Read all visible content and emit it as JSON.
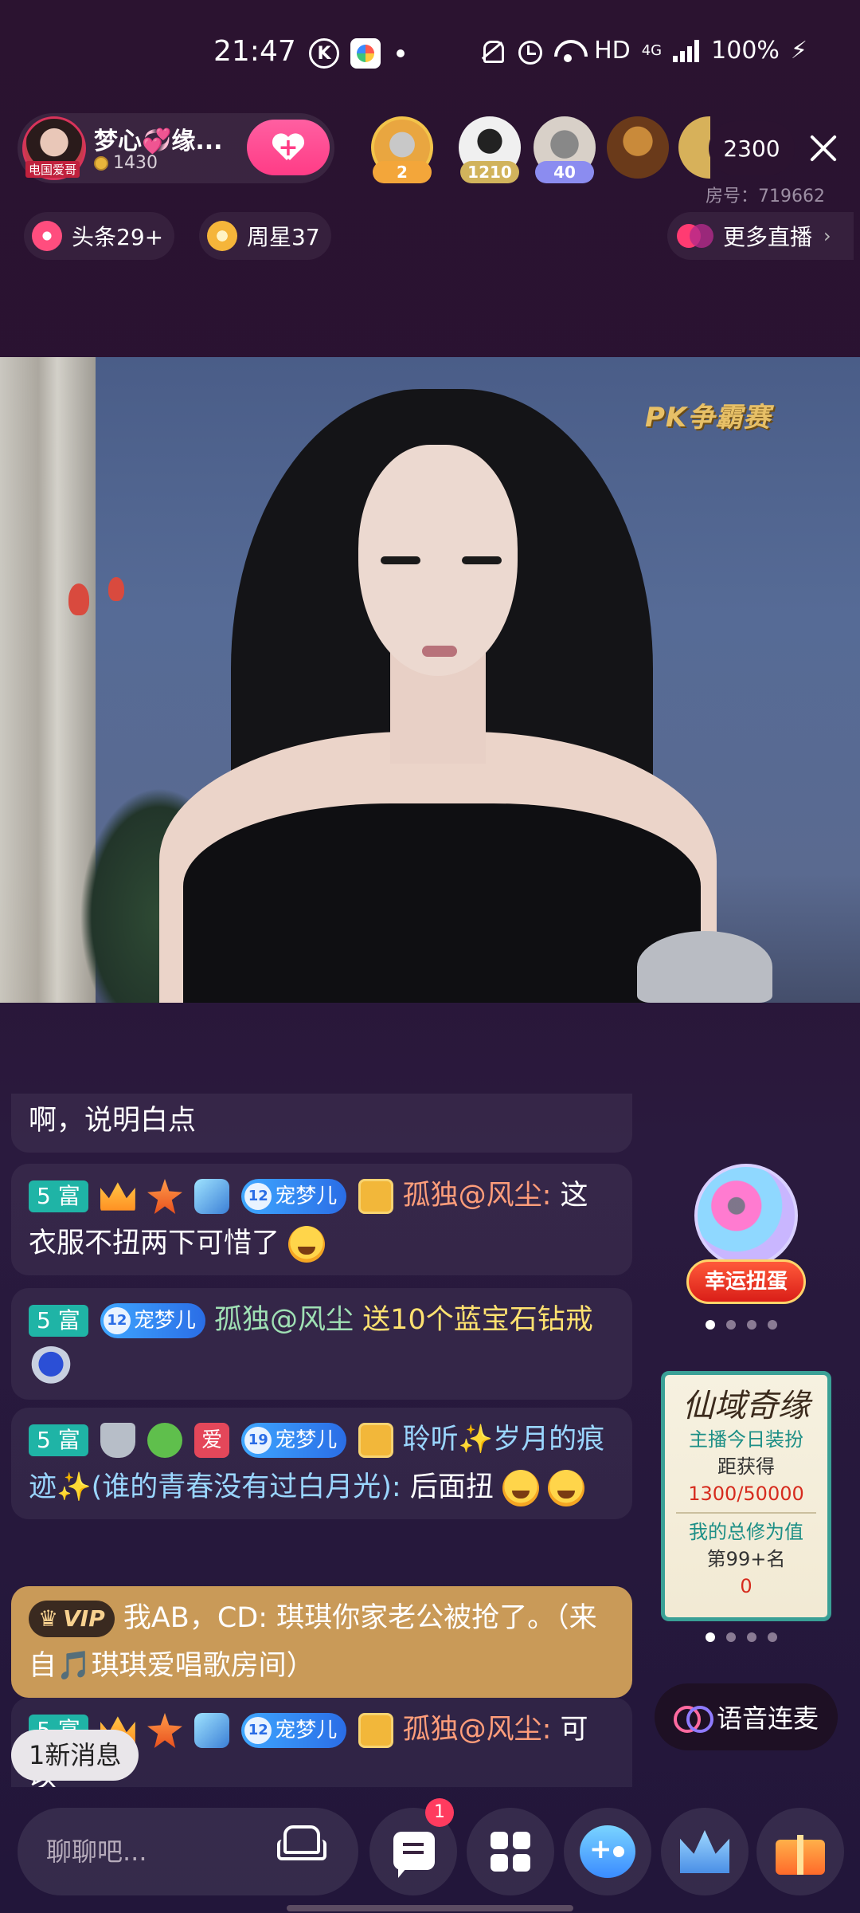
{
  "status_bar": {
    "time": "21:47",
    "k_icon": "K",
    "network": "HD",
    "mobile": "4G",
    "battery": "100%",
    "icons": [
      "k-circle-icon",
      "app-icon",
      "mute-bell-icon",
      "alarm-icon",
      "wifi-icon",
      "signal-icon",
      "charging-icon"
    ]
  },
  "host": {
    "name": "梦心💞缘...",
    "coins": "1430",
    "avatar_tag": "电国爱哥"
  },
  "viewers": [
    {
      "badge": "2",
      "badge_color": "#f3a63a",
      "face_color": "#e9a640"
    },
    {
      "badge": "1210",
      "badge_color": "#d1b35c",
      "face_color": "#f0f0f0"
    },
    {
      "badge": "40",
      "badge_color": "#8b8cf0",
      "face_color": "#d8d0c8"
    },
    {
      "badge": "",
      "badge_color": "",
      "face_color": "#6a3a1a"
    }
  ],
  "viewer_count": "2300",
  "room_number": "房号：719662",
  "tags": {
    "headline": "头条29+",
    "weekly_star": "周星37",
    "more_live": "更多直播"
  },
  "video": {
    "pk_logo": "PK争霸赛"
  },
  "chat": {
    "messages": [
      {
        "text": "啊，说明白点"
      },
      {
        "level": "5 富",
        "fan_level": "12",
        "fan_name": "宠梦儿",
        "user": "孤独@风尘:",
        "text": "这衣服不扭两下可惜了"
      },
      {
        "level": "5 富",
        "fan_level": "12",
        "fan_name": "宠梦儿",
        "user": "孤独@风尘",
        "gift": "送10个蓝宝石钻戒"
      },
      {
        "level": "5 富",
        "guard": "守",
        "love": "爱",
        "fan_level": "19",
        "fan_name": "宠梦儿",
        "user": "聆听✨岁月的痕迹✨(谁的青春没有过白月光):",
        "text": "后面扭"
      },
      {
        "vip": "VIP",
        "text": "我AB，CD: 琪琪你家老公被抢了。（来自🎵琪琪爱唱歌房间）"
      },
      {
        "level": "5 富",
        "fan_level": "12",
        "fan_name": "宠梦儿",
        "user": "孤独@风尘:",
        "text": "可以"
      }
    ],
    "new_messages": "1新消息"
  },
  "widgets": {
    "gacha_label": "幸运扭蛋",
    "xianyu": {
      "title": "仙域奇缘",
      "line1": "主播今日装扮",
      "line2": "距获得",
      "progress": "1300/50000",
      "line3": "我的总修为值",
      "rank": "第99+名",
      "value": "0"
    },
    "voice_link": "语音连麦"
  },
  "bottom_bar": {
    "input_placeholder": "聊聊吧...",
    "notification_count": "1"
  }
}
